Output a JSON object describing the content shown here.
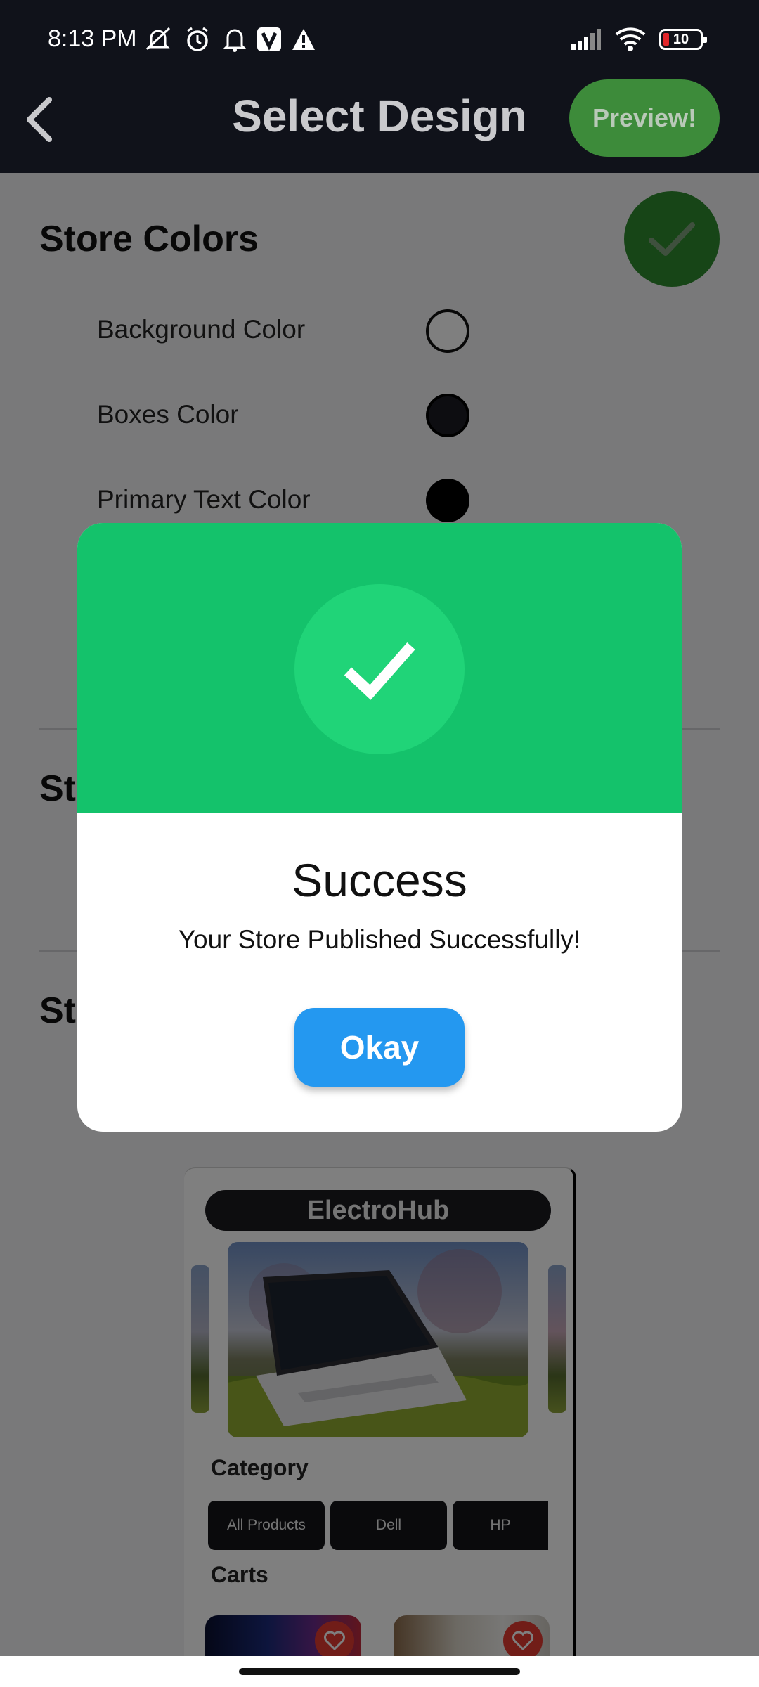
{
  "status_bar": {
    "time": "8:13 PM",
    "battery": "10",
    "icons": [
      "mute-icon",
      "alarm-icon",
      "notification-bell-icon",
      "v-app-icon",
      "warning-icon",
      "signal-icon",
      "wifi-icon",
      "battery-icon"
    ]
  },
  "app_bar": {
    "title": "Select Design",
    "preview_label": "Preview!",
    "back_icon": "back-arrow-icon"
  },
  "store_colors": {
    "title": "Store Colors",
    "items": [
      {
        "label": "Background Color",
        "color": "#ffffff"
      },
      {
        "label": "Boxes Color",
        "color": "#1b1b22"
      },
      {
        "label": "Primary Text Color",
        "color": "#000000"
      }
    ]
  },
  "sections": {
    "second_partial": "St",
    "third_partial": "St"
  },
  "preview": {
    "store_name": "ElectroHub",
    "category_title": "Category",
    "categories": [
      "All Products",
      "Dell",
      "HP"
    ],
    "carts_title": "Carts"
  },
  "dialog": {
    "title": "Success",
    "message": "Your Store Published Successfully!",
    "button": "Okay",
    "header_color": "#14c26b",
    "button_color": "#2498f0"
  },
  "colors": {
    "accent_green": "#3d8b3a",
    "app_bar": "#10121a"
  }
}
